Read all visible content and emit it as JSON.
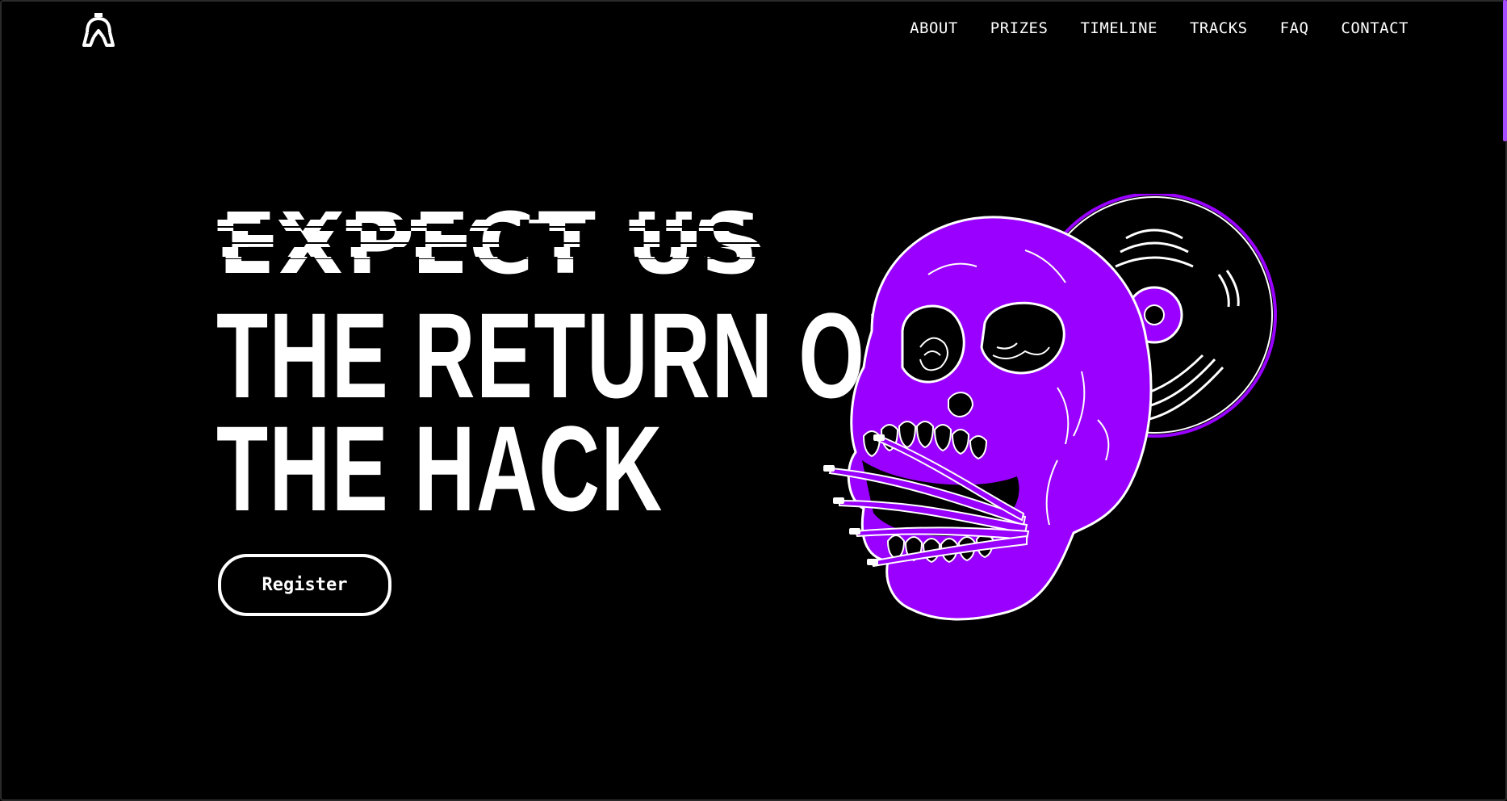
{
  "header": {
    "logo_icon": "hacker-emblem-icon",
    "nav": [
      {
        "label": "ABOUT"
      },
      {
        "label": "PRIZES"
      },
      {
        "label": "TIMELINE"
      },
      {
        "label": "TRACKS"
      },
      {
        "label": "FAQ"
      },
      {
        "label": "CONTACT"
      }
    ]
  },
  "hero": {
    "glitch_text": "EXPECT US",
    "headline_line1": "THE RETURN OF",
    "headline_line2": "THE HACK",
    "register_label": "Register",
    "illustration": "purple-skull-with-vinyl-record"
  },
  "colors": {
    "background": "#000000",
    "accent": "#9a00ff",
    "text": "#ffffff"
  }
}
